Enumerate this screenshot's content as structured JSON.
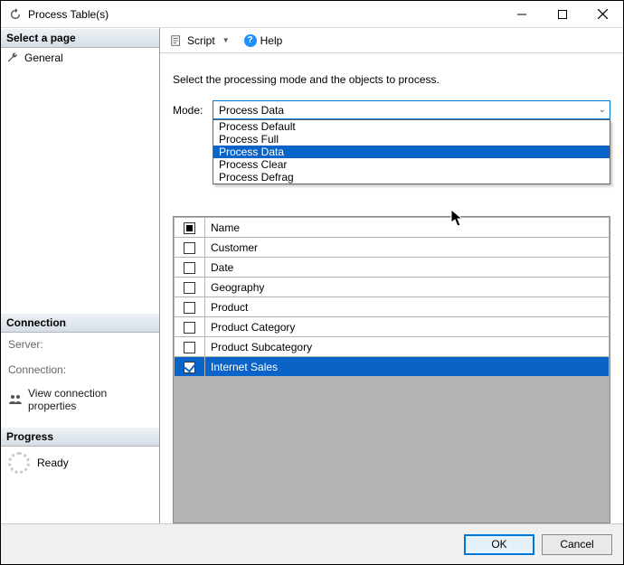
{
  "window": {
    "title": "Process Table(s)"
  },
  "sidebar": {
    "select_page_header": "Select a page",
    "nav": {
      "general": "General"
    },
    "connection_header": "Connection",
    "server_label": "Server:",
    "connection_label": "Connection:",
    "view_props": "View connection properties",
    "progress_header": "Progress",
    "progress_status": "Ready"
  },
  "toolbar": {
    "script": "Script",
    "help": "Help"
  },
  "main": {
    "instruction": "Select the processing mode and the objects to process.",
    "mode_label": "Mode:",
    "mode_selected": "Process Data",
    "mode_options": [
      "Process Default",
      "Process Full",
      "Process Data",
      "Process Clear",
      "Process Defrag"
    ],
    "name_header": "Name",
    "rows": [
      {
        "name": "Customer",
        "checked": false,
        "selected": false
      },
      {
        "name": "Date",
        "checked": false,
        "selected": false
      },
      {
        "name": "Geography",
        "checked": false,
        "selected": false
      },
      {
        "name": "Product",
        "checked": false,
        "selected": false
      },
      {
        "name": "Product Category",
        "checked": false,
        "selected": false
      },
      {
        "name": "Product Subcategory",
        "checked": false,
        "selected": false
      },
      {
        "name": "Internet Sales",
        "checked": true,
        "selected": true
      }
    ]
  },
  "footer": {
    "ok": "OK",
    "cancel": "Cancel"
  },
  "colors": {
    "accent": "#0a64c8",
    "border_focus": "#0078d7"
  }
}
